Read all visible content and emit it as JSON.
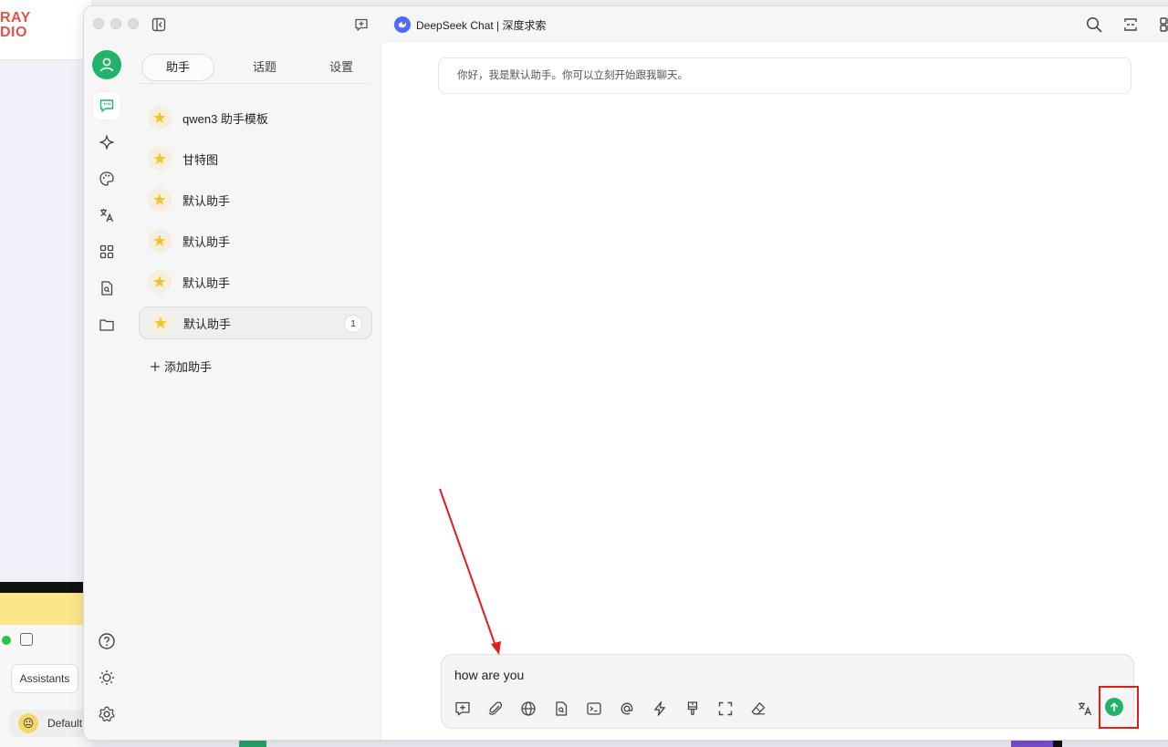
{
  "background": {
    "logo_line1": "RAY",
    "logo_line2": "DIO",
    "assistants_label": "Assistants",
    "default_label": "Default",
    "default_face": "😐"
  },
  "window": {
    "title": "DeepSeek Chat | 深度求索"
  },
  "tabs": [
    {
      "label": "助手"
    },
    {
      "label": "话题"
    },
    {
      "label": "设置"
    }
  ],
  "assistants": [
    {
      "name": "qwen3 助手模板"
    },
    {
      "name": "甘特图"
    },
    {
      "name": "默认助手"
    },
    {
      "name": "默认助手"
    },
    {
      "name": "默认助手"
    },
    {
      "name": "默认助手",
      "badge": "1"
    }
  ],
  "add_assistant_label": "添加助手",
  "greeting": "你好，我是默认助手。你可以立刻开始跟我聊天。",
  "input": {
    "value": "how are you"
  },
  "colors": {
    "accent_green": "#1fb46a",
    "annotation_red": "#e21b1b",
    "deepseek_blue": "#4d6bfe"
  }
}
